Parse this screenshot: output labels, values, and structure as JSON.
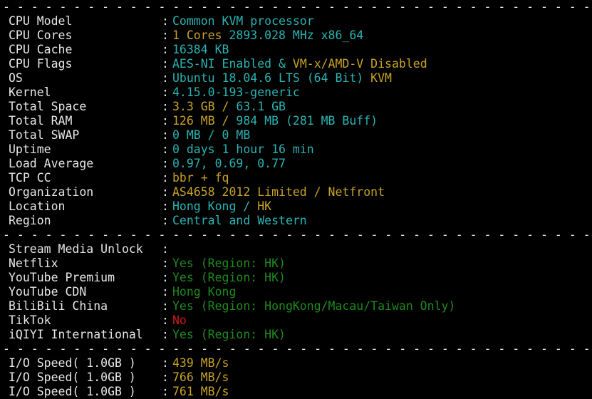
{
  "separator": "- - - - - - - - - - - - - - - - - - - - - - - - - - - - - - - - - - - - - - - - - - - - - - - - - - - - - - - - - - - - - - - - - - - - - - - - - - - - - - - - - - -",
  "colors": {
    "background": "#000000",
    "label": "#e6e6e6",
    "cyan": "#2ab3b3",
    "yellow": "#c9a227",
    "green": "#1e8a1e",
    "red": "#d01818"
  },
  "system": [
    {
      "label": "CPU Model",
      "segments": [
        {
          "text": "Common KVM processor",
          "color": "cyan"
        }
      ]
    },
    {
      "label": "CPU Cores",
      "segments": [
        {
          "text": "1 Cores ",
          "color": "yellow"
        },
        {
          "text": "2893.028 MHz x86_64",
          "color": "cyan"
        }
      ]
    },
    {
      "label": "CPU Cache",
      "segments": [
        {
          "text": "16384 KB",
          "color": "cyan"
        }
      ]
    },
    {
      "label": "CPU Flags",
      "segments": [
        {
          "text": "AES-NI Enabled & ",
          "color": "cyan"
        },
        {
          "text": "VM-x/AMD-V Disabled",
          "color": "yellow"
        }
      ]
    },
    {
      "label": "OS",
      "segments": [
        {
          "text": "Ubuntu 18.04.6 LTS (64 Bit) ",
          "color": "cyan"
        },
        {
          "text": "KVM",
          "color": "yellow"
        }
      ]
    },
    {
      "label": "Kernel",
      "segments": [
        {
          "text": "4.15.0-193-generic",
          "color": "cyan"
        }
      ]
    },
    {
      "label": "Total Space",
      "segments": [
        {
          "text": "3.3 GB / ",
          "color": "yellow"
        },
        {
          "text": "63.1 GB",
          "color": "cyan"
        }
      ]
    },
    {
      "label": "Total RAM",
      "segments": [
        {
          "text": "126 MB / ",
          "color": "yellow"
        },
        {
          "text": "984 MB ",
          "color": "cyan"
        },
        {
          "text": "(281 MB Buff)",
          "color": "cyan"
        }
      ]
    },
    {
      "label": "Total SWAP",
      "segments": [
        {
          "text": "0 MB / ",
          "color": "cyan"
        },
        {
          "text": "0 MB",
          "color": "cyan"
        }
      ]
    },
    {
      "label": "Uptime",
      "segments": [
        {
          "text": "0 days 1 hour 16 min",
          "color": "cyan"
        }
      ]
    },
    {
      "label": "Load Average",
      "segments": [
        {
          "text": "0.97, 0.69, 0.77",
          "color": "cyan"
        }
      ]
    },
    {
      "label": "TCP CC",
      "segments": [
        {
          "text": "bbr + fq",
          "color": "yellow"
        }
      ]
    },
    {
      "label": "Organization",
      "segments": [
        {
          "text": "AS4658 2012 Limited / Netfront",
          "color": "yellow"
        }
      ]
    },
    {
      "label": "Location",
      "segments": [
        {
          "text": "Hong Kong / ",
          "color": "cyan"
        },
        {
          "text": "HK",
          "color": "yellow"
        }
      ]
    },
    {
      "label": "Region",
      "segments": [
        {
          "text": "Central and Western",
          "color": "cyan"
        }
      ]
    }
  ],
  "stream": [
    {
      "label": "Stream Media Unlock",
      "segments": []
    },
    {
      "label": "Netflix",
      "segments": [
        {
          "text": "Yes (Region: HK)",
          "color": "green"
        }
      ]
    },
    {
      "label": "YouTube Premium",
      "segments": [
        {
          "text": "Yes (Region: HK)",
          "color": "green"
        }
      ]
    },
    {
      "label": "YouTube CDN",
      "segments": [
        {
          "text": "Hong Kong",
          "color": "green"
        }
      ]
    },
    {
      "label": "BiliBili China",
      "segments": [
        {
          "text": "Yes (Region: HongKong/Macau/Taiwan Only)",
          "color": "green"
        }
      ]
    },
    {
      "label": "TikTok",
      "segments": [
        {
          "text": "No",
          "color": "red"
        }
      ]
    },
    {
      "label": "iQIYI International",
      "segments": [
        {
          "text": "Yes (Region: HK)",
          "color": "green"
        }
      ]
    }
  ],
  "io": [
    {
      "label": "I/O Speed( 1.0GB )",
      "segments": [
        {
          "text": "439 MB/s",
          "color": "yellow"
        }
      ]
    },
    {
      "label": "I/O Speed( 1.0GB )",
      "segments": [
        {
          "text": "766 MB/s",
          "color": "yellow"
        }
      ]
    },
    {
      "label": "I/O Speed( 1.0GB )",
      "segments": [
        {
          "text": "761 MB/s",
          "color": "yellow"
        }
      ]
    }
  ],
  "colon": ":"
}
